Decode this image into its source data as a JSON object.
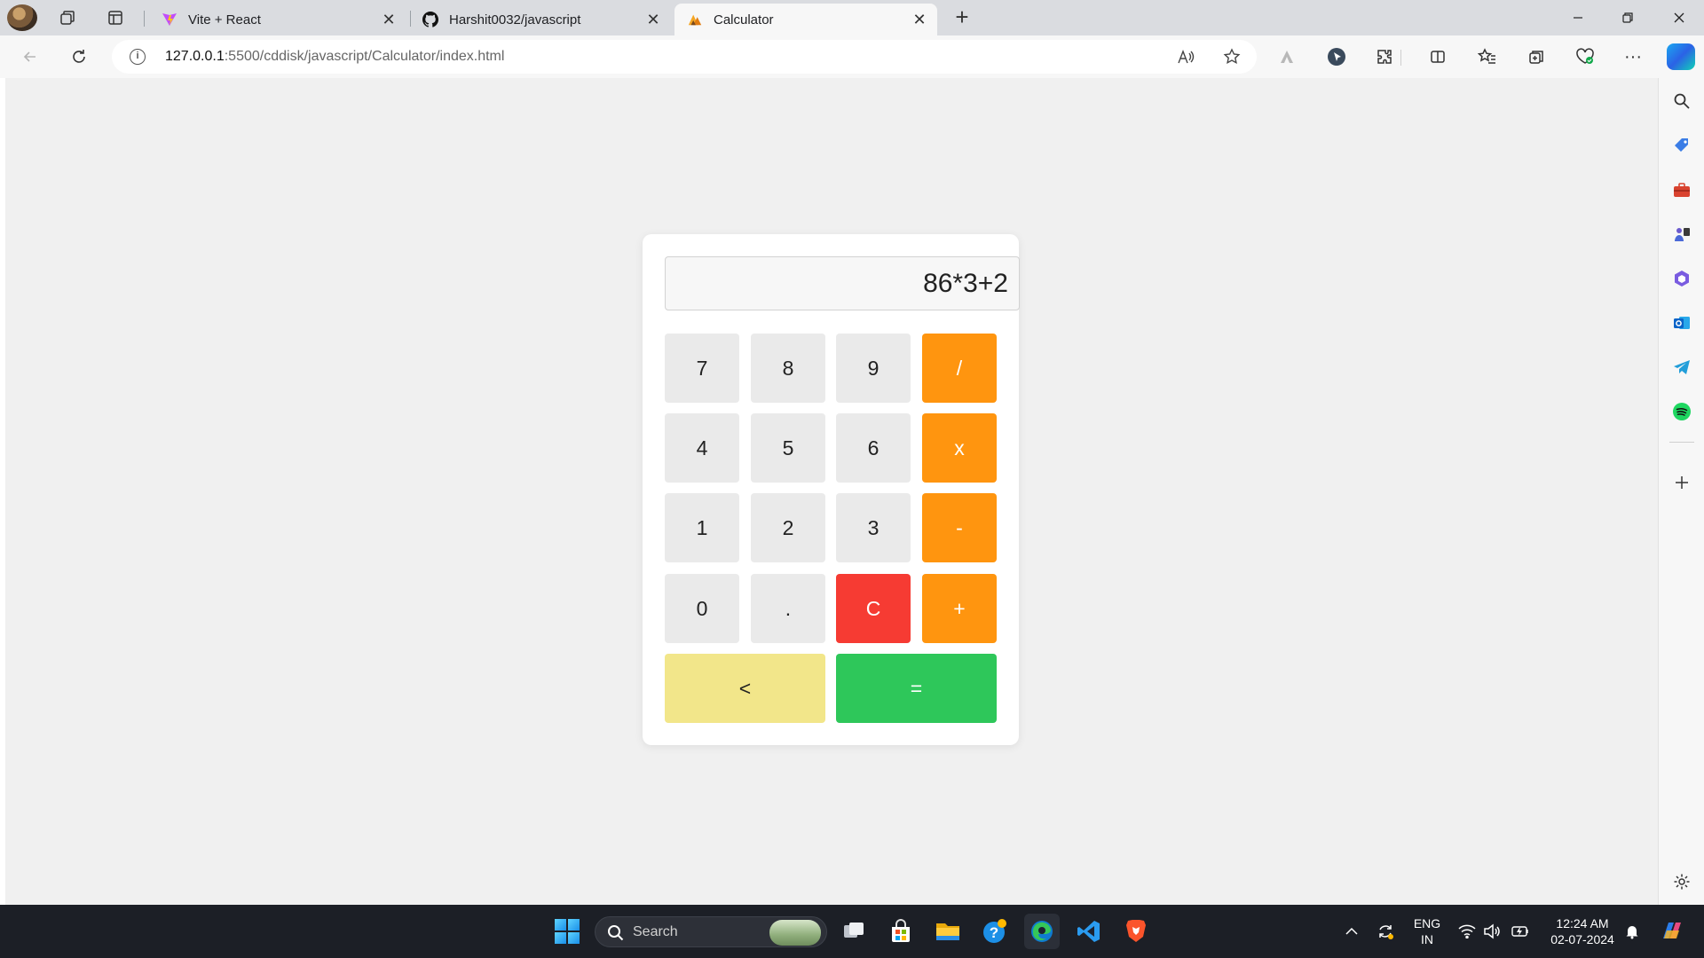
{
  "browser": {
    "tabs": [
      {
        "title": "Vite + React",
        "active": false
      },
      {
        "title": "Harshit0032/javascript",
        "active": false
      },
      {
        "title": "Calculator",
        "active": true
      }
    ],
    "address": {
      "url_host": "127.0.0.1",
      "url_rest": ":5500/cddisk/javascript/Calculator/index.html"
    }
  },
  "calculator": {
    "display_value": "86*3+2",
    "keys": {
      "k7": "7",
      "k8": "8",
      "k9": "9",
      "divide": "/",
      "k4": "4",
      "k5": "5",
      "k6": "6",
      "multiply": "x",
      "k1": "1",
      "k2": "2",
      "k3": "3",
      "subtract": "-",
      "k0": "0",
      "decimal": ".",
      "clear": "C",
      "add": "+",
      "backspace": "<",
      "equals": "="
    },
    "colors": {
      "operator": "#ff950f",
      "clear": "#f63b33",
      "backspace": "#f2e68a",
      "equals": "#2ec75a",
      "number": "#eaeaea"
    }
  },
  "taskbar": {
    "search_placeholder": "Search",
    "language": {
      "line1": "ENG",
      "line2": "IN"
    },
    "clock": {
      "time": "12:24 AM",
      "date": "02-07-2024"
    }
  }
}
